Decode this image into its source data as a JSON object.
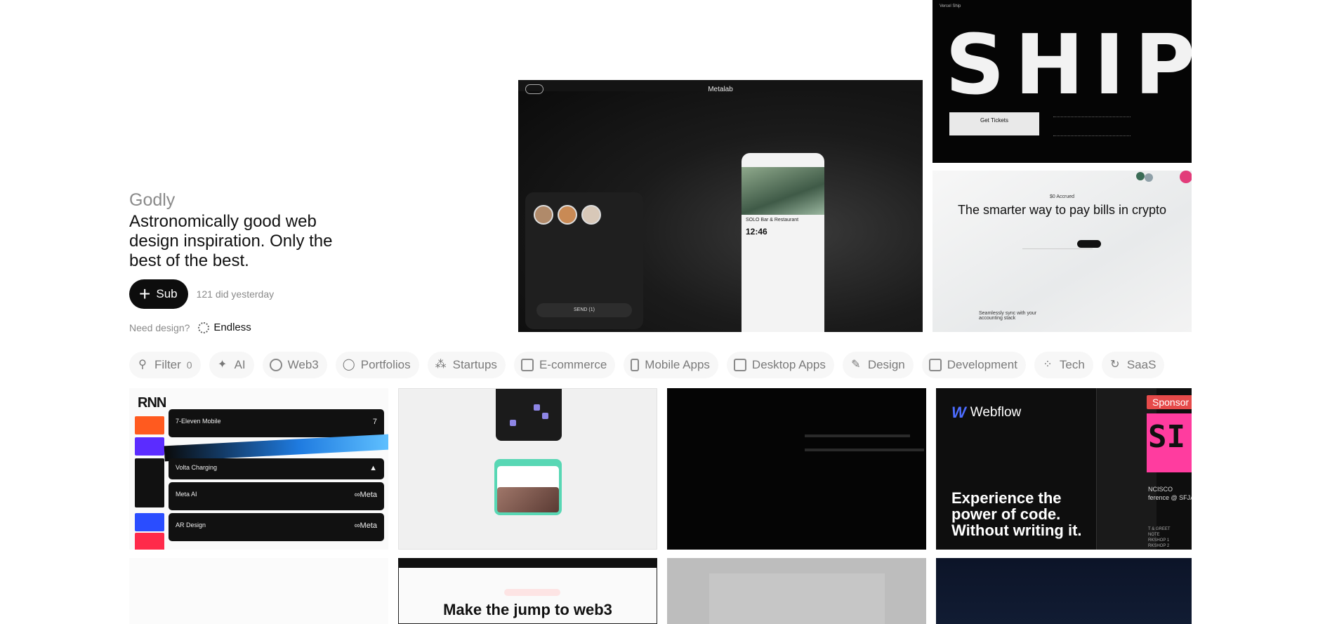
{
  "intro": {
    "brand": "Godly",
    "tagline": "Astronomically good web design inspiration. Only the best of the best.",
    "sub_label": "Sub",
    "sub_count": "121 did yesterday",
    "need_design": "Need design?",
    "endless": "Endless"
  },
  "hero": {
    "metalab": {
      "logo": "Metalab",
      "restaurant": "SOLO Bar & Restaurant",
      "time": "12:46",
      "send": "SEND (1)"
    },
    "ship": {
      "headline": "SHIP",
      "title": "Vercel Ship",
      "tickets": "Get Tickets"
    },
    "crypto": {
      "accrued": "$0 Accrued",
      "headline": "The smarter way to pay bills in crypto",
      "footer": "Seamlessly sync with your accounting stack"
    }
  },
  "filters": [
    {
      "label": "Filter",
      "icon": "sliders-icon",
      "badge": "0"
    },
    {
      "label": "AI",
      "icon": "sparkle-icon"
    },
    {
      "label": "Web3",
      "icon": "planet-icon"
    },
    {
      "label": "Portfolios",
      "icon": "portfolio-icon"
    },
    {
      "label": "Startups",
      "icon": "startup-icon"
    },
    {
      "label": "E-commerce",
      "icon": "card-icon"
    },
    {
      "label": "Mobile Apps",
      "icon": "phone-icon"
    },
    {
      "label": "Desktop Apps",
      "icon": "desktop-icon"
    },
    {
      "label": "Design",
      "icon": "pen-icon"
    },
    {
      "label": "Development",
      "icon": "code-icon"
    },
    {
      "label": "Tech",
      "icon": "chip-icon"
    },
    {
      "label": "SaaS",
      "icon": "refresh-icon"
    }
  ],
  "cards": {
    "c1": {
      "logo": "RNN",
      "rows": [
        {
          "name": "7-Eleven Mobile",
          "mark": "7"
        },
        {
          "name": "Volta Charging",
          "mark": "▲"
        },
        {
          "name": "Meta AI",
          "mark": "∞Meta"
        },
        {
          "name": "AR Design",
          "mark": "∞Meta"
        }
      ]
    },
    "c4": {
      "brand": "Webflow",
      "slogan": "Experience the power of code. Without writing it.",
      "sponsor": "Sponsor",
      "pink_text": "SI",
      "cal": "NCISCO\nference @ SFJAZZ",
      "cal2": "T & GREET\nNOTE\nRKSHOP 1\nRKSHOP 2"
    },
    "c6": {
      "headline": "Make the jump to web3"
    }
  },
  "colors": {
    "chip_bg": "#f7f7f7",
    "chip_text": "#7a7a7a",
    "sub_bg": "#0d0d0d",
    "webflow_blue": "#4c6cff",
    "sponsor_red": "#e64a4a"
  }
}
